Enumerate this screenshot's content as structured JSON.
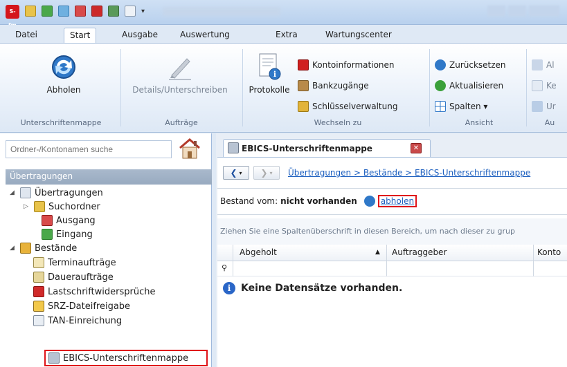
{
  "app": {
    "logo_text": "S-fm"
  },
  "menu_tabs": [
    {
      "label": "Datei"
    },
    {
      "label": "Start"
    },
    {
      "label": "Ausgabe"
    },
    {
      "label": "Auswertung"
    },
    {
      "label": "Extra"
    },
    {
      "label": "Wartungscenter"
    }
  ],
  "ribbon": {
    "groups": {
      "unterschriftenmappe": "Unterschriftenmappe",
      "auftraege": "Aufträge",
      "wechseln_zu": "Wechseln zu",
      "ansicht": "Ansicht",
      "cut": "Au"
    },
    "abholen": "Abholen",
    "details": "Details/Unterschreiben",
    "protokolle": "Protokolle",
    "kontoinformationen": "Kontoinformationen",
    "bankzugaenge": "Bankzugänge",
    "schluessel": "Schlüsselverwaltung",
    "zuruecksetzen": "Zurücksetzen",
    "aktualisieren": "Aktualisieren",
    "spalten": "Spalten ▾",
    "cut1": "Al",
    "cut2": "Ke",
    "cut3": "Ur"
  },
  "left": {
    "search_placeholder": "Ordner-/Kontonamen suche",
    "section": "Übertragungen",
    "tree": [
      {
        "label": "Übertragungen"
      },
      {
        "label": "Suchordner"
      },
      {
        "label": "Ausgang"
      },
      {
        "label": "Eingang"
      },
      {
        "label": "Bestände"
      },
      {
        "label": "Terminaufträge"
      },
      {
        "label": "Daueraufträge"
      },
      {
        "label": "Lastschriftwidersprüche"
      },
      {
        "label": "SRZ-Dateifreigabe"
      },
      {
        "label": "TAN-Einreichung"
      },
      {
        "label": "EBICS-Unterschriftenmappe"
      }
    ]
  },
  "right": {
    "tab_title": "EBICS-Unterschriftenmappe",
    "breadcrumb": "Übertragungen > Bestände > EBICS-Unterschriftenmappe",
    "bestand_prefix": "Bestand vom:",
    "bestand_value": "nicht vorhanden",
    "abholen_link": "abholen",
    "group_hint": "Ziehen Sie eine Spaltenüberschrift in diesen Bereich, um nach dieser zu grup",
    "columns": [
      "Abgeholt",
      "Auftraggeber",
      "Konto"
    ],
    "empty_message": "Keine Datensätze vorhanden."
  }
}
